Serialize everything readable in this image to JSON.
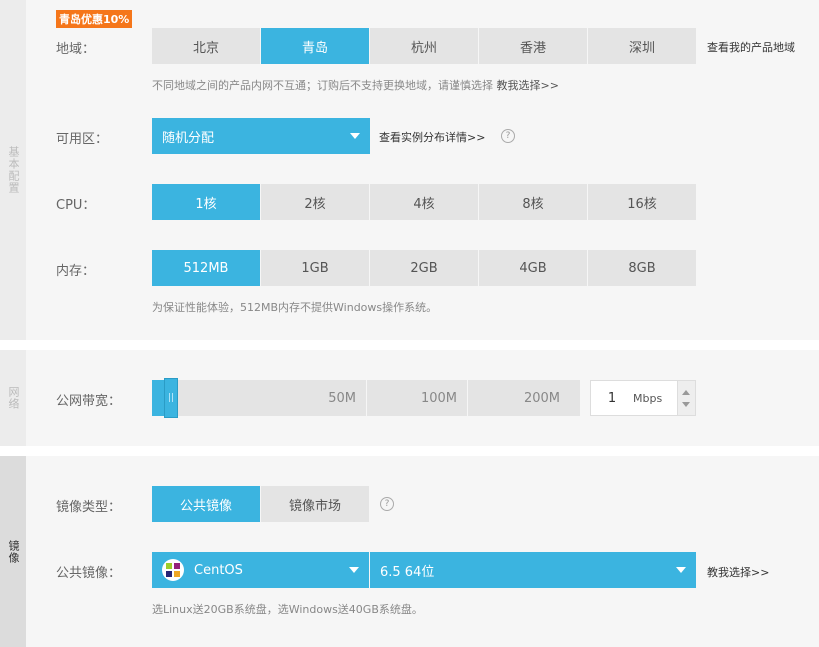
{
  "basic": {
    "side_label": "基本配置",
    "promo_badge": "青岛优惠10%",
    "region": {
      "label": "地域：",
      "options": [
        "北京",
        "青岛",
        "杭州",
        "香港",
        "深圳"
      ],
      "selected": "青岛",
      "my_regions_link": "查看我的产品地域",
      "hint_text": "不同地域之间的产品内网不互通；订购后不支持更换地域，请谨慎选择",
      "hint_link": "教我选择>>"
    },
    "zone": {
      "label": "可用区：",
      "value": "随机分配",
      "detail_link": "查看实例分布详情>>",
      "help_icon": "question-circle-icon"
    },
    "cpu": {
      "label": "CPU：",
      "options": [
        "1核",
        "2核",
        "4核",
        "8核",
        "16核"
      ],
      "selected": "1核"
    },
    "memory": {
      "label": "内存：",
      "options": [
        "512MB",
        "1GB",
        "2GB",
        "4GB",
        "8GB"
      ],
      "selected": "512MB",
      "hint": "为保证性能体验，512MB内存不提供Windows操作系统。"
    }
  },
  "network": {
    "side_label": "网络",
    "bandwidth": {
      "label": "公网带宽：",
      "ticks": [
        "50M",
        "100M",
        "200M"
      ],
      "value": "1",
      "unit": "Mbps",
      "level_mbps": 1
    }
  },
  "image": {
    "side_label": "镜像",
    "type": {
      "label": "镜像类型：",
      "options": [
        "公共镜像",
        "镜像市场"
      ],
      "selected": "公共镜像",
      "help_icon": "question-circle-icon"
    },
    "public": {
      "label": "公共镜像：",
      "os": "CentOS",
      "os_icon": "centos-logo-icon",
      "version": "6.5 64位",
      "help_link": "教我选择>>",
      "hint": "选Linux送20GB系统盘，选Windows送40GB系统盘。"
    }
  },
  "colors": {
    "accent": "#3bb4e0",
    "badge": "#f5761a",
    "option_bg": "#e4e4e4",
    "section_bg": "#f6f6f6"
  }
}
